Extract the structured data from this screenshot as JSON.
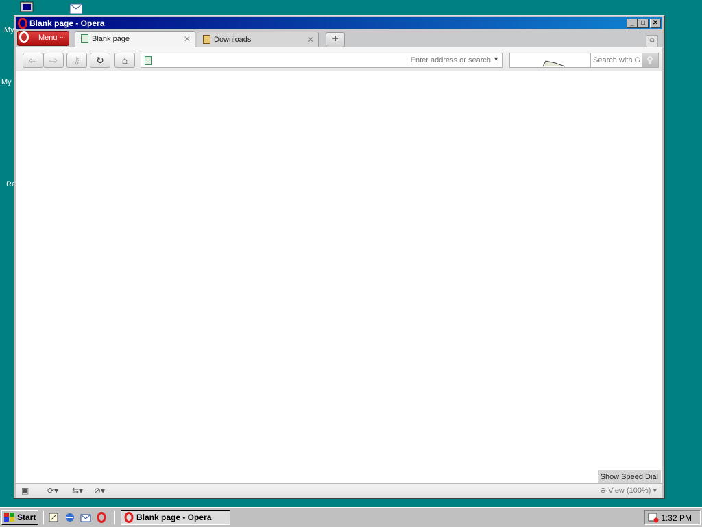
{
  "desktop": {
    "icons": [
      {
        "name": "desktop-icon-my-computer",
        "label": "My",
        "icon": "computer-icon"
      },
      {
        "name": "desktop-icon-my-documents",
        "label": "My",
        "icon": "documents-icon"
      },
      {
        "name": "desktop-icon-recycle-bin",
        "label": "Re",
        "icon": "recycle-bin-icon"
      }
    ]
  },
  "window": {
    "title": "Blank page - Opera",
    "buttons": {
      "minimize": "_",
      "maximize": "□",
      "close": "✕"
    }
  },
  "tabstrip": {
    "menu_label": "Menu",
    "tabs": [
      {
        "label": "Blank page",
        "active": true,
        "icon": "page-icon"
      },
      {
        "label": "Downloads",
        "active": false,
        "icon": "downloads-icon"
      }
    ],
    "new_tab_label": "+"
  },
  "navbar": {
    "address_placeholder": "Enter address or search",
    "search_placeholder": "Search with G"
  },
  "content": {
    "speed_dial_label": "Show Speed Dial"
  },
  "statusbar": {
    "zoom_label": "View (100%)"
  },
  "taskbar": {
    "start_label": "Start",
    "task_label": "Blank page - Opera",
    "clock": "1:32 PM"
  },
  "colors": {
    "desktop": "#008080",
    "titlebar_start": "#000080",
    "titlebar_end": "#1084d0",
    "opera_red": "#cc1f1f"
  }
}
